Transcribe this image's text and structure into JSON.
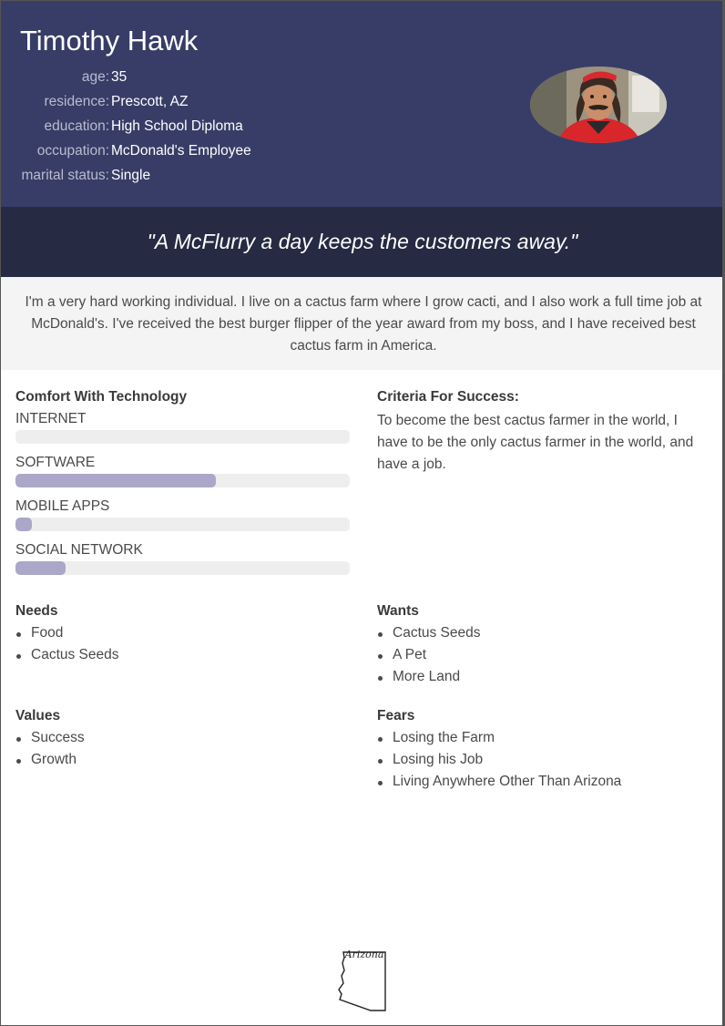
{
  "persona": {
    "name": "Timothy Hawk",
    "profile": [
      {
        "label": "age:",
        "value": "35"
      },
      {
        "label": "residence:",
        "value": "Prescott, AZ"
      },
      {
        "label": "education:",
        "value": "High School Diploma"
      },
      {
        "label": "occupation:",
        "value": "McDonald's Employee"
      },
      {
        "label": "marital status:",
        "value": "Single"
      }
    ],
    "avatar_icon": "person-photo"
  },
  "quote": "\"A McFlurry a day keeps the customers away.\"",
  "bio": "I'm a very hard working individual. I live on a cactus farm where I grow cacti, and I also work a full time job at McDonald's. I've received the best burger flipper of the year award from my boss, and I have received best cactus farm in America.",
  "technology": {
    "title": "Comfort With Technology",
    "bars": [
      {
        "label": "INTERNET",
        "level": 0.0
      },
      {
        "label": "SOFTWARE",
        "level": 0.6
      },
      {
        "label": "MOBILE APPS",
        "level": 0.05
      },
      {
        "label": "SOCIAL NETWORK",
        "level": 0.15
      }
    ],
    "fill_color": "#aaa7c9",
    "track_color": "#eeeeee"
  },
  "criteria": {
    "title": "Criteria For Success:",
    "text": "To become the best cactus farmer in the world, I have to be the only cactus farmer in the world, and have a job."
  },
  "needs": {
    "title": "Needs",
    "items": [
      "Food",
      "Cactus Seeds"
    ]
  },
  "wants": {
    "title": "Wants",
    "items": [
      "Cactus Seeds",
      "A Pet",
      "More Land"
    ]
  },
  "values": {
    "title": "Values",
    "items": [
      "Success",
      "Growth"
    ]
  },
  "fears": {
    "title": "Fears",
    "items": [
      "Losing the Farm",
      "Losing his Job",
      "Living Anywhere Other Than Arizona"
    ]
  },
  "footer": {
    "logo_text": "Arizona",
    "logo_icon": "arizona-state-outline-icon"
  },
  "colors": {
    "header": "#383d67",
    "quote_band": "#262a43",
    "bio_band": "#f4f4f4"
  }
}
